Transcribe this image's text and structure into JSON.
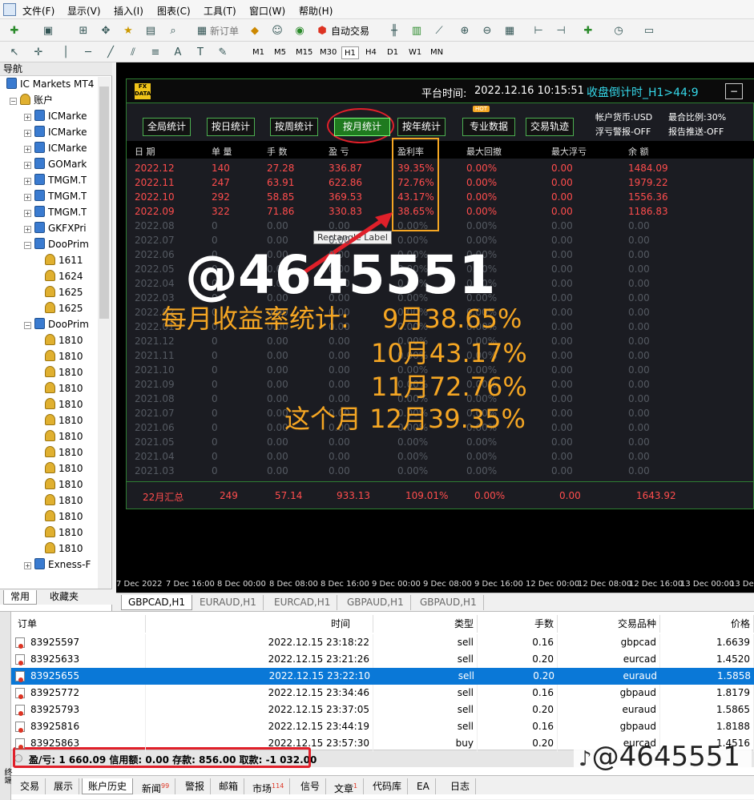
{
  "menu": [
    "文件(F)",
    "显示(V)",
    "插入(I)",
    "图表(C)",
    "工具(T)",
    "窗口(W)",
    "帮助(H)"
  ],
  "toolbar": {
    "new_order": "新订单",
    "auto_trading": "自动交易",
    "timeframes": [
      "M1",
      "M5",
      "M15",
      "M30",
      "H1",
      "H4",
      "D1",
      "W1",
      "MN"
    ],
    "active_tf": "H1"
  },
  "navigator": {
    "title": "导航",
    "root": "IC Markets MT4",
    "accounts_label": "账户",
    "items": [
      {
        "label": "ICMarke",
        "type": "account"
      },
      {
        "label": "ICMarke",
        "type": "account"
      },
      {
        "label": "ICMarke",
        "type": "account"
      },
      {
        "label": "GOMark",
        "type": "account"
      },
      {
        "label": "TMGM.T",
        "type": "account"
      },
      {
        "label": "TMGM.T",
        "type": "account"
      },
      {
        "label": "TMGM.T",
        "type": "account"
      },
      {
        "label": "GKFXPri",
        "type": "account"
      },
      {
        "label": "DooPrim",
        "type": "account"
      },
      {
        "label": "1611",
        "type": "user"
      },
      {
        "label": "1624",
        "type": "user"
      },
      {
        "label": "1625",
        "type": "user"
      },
      {
        "label": "1625",
        "type": "user"
      },
      {
        "label": "DooPrim",
        "type": "account"
      },
      {
        "label": "1810",
        "type": "user"
      },
      {
        "label": "1810",
        "type": "user"
      },
      {
        "label": "1810",
        "type": "user"
      },
      {
        "label": "1810",
        "type": "user"
      },
      {
        "label": "1810",
        "type": "user"
      },
      {
        "label": "1810",
        "type": "user"
      },
      {
        "label": "1810",
        "type": "user"
      },
      {
        "label": "1810",
        "type": "user"
      },
      {
        "label": "1810",
        "type": "user"
      },
      {
        "label": "1810",
        "type": "user"
      },
      {
        "label": "1810",
        "type": "user"
      },
      {
        "label": "1810",
        "type": "user"
      },
      {
        "label": "1810",
        "type": "user"
      },
      {
        "label": "1810",
        "type": "user"
      },
      {
        "label": "Exness-F",
        "type": "account"
      }
    ],
    "tabs": [
      "常用",
      "收藏夹"
    ]
  },
  "panel": {
    "platform_time_label": "平台时间:",
    "platform_time": "2022.12.16 10:15:51",
    "countdown": "收盘倒计时_H1>44:9",
    "close_btn": "−",
    "tabs": [
      "全局统计",
      "按日统计",
      "按周统计",
      "按月统计",
      "按年统计",
      "专业数据",
      "交易轨迹"
    ],
    "active_tab": "按月统计",
    "hot_badge": "HOT",
    "info": {
      "currency": "帐户货币:USD",
      "max_ratio": "最合比例:30%",
      "float_alert": "浮亏警报-OFF",
      "report_push": "报告推送-OFF"
    },
    "columns": [
      "日 期",
      "单 量",
      "手 数",
      "盈 亏",
      "盈利率",
      "最大回撤",
      "最大浮亏",
      "余 额"
    ],
    "rows": [
      [
        "2022.12",
        "140",
        "27.28",
        "336.87",
        "39.35%",
        "0.00%",
        "0.00",
        "1484.09"
      ],
      [
        "2022.11",
        "247",
        "63.91",
        "622.86",
        "72.76%",
        "0.00%",
        "0.00",
        "1979.22"
      ],
      [
        "2022.10",
        "292",
        "58.85",
        "369.53",
        "43.17%",
        "0.00%",
        "0.00",
        "1556.36"
      ],
      [
        "2022.09",
        "322",
        "71.86",
        "330.83",
        "38.65%",
        "0.00%",
        "0.00",
        "1186.83"
      ],
      [
        "2022.08",
        "0",
        "0.00",
        "0.00",
        "0.00%",
        "0.00%",
        "0.00",
        "0.00"
      ],
      [
        "2022.07",
        "0",
        "0.00",
        "0.00",
        "0.00%",
        "0.00%",
        "0.00",
        "0.00"
      ],
      [
        "2022.06",
        "0",
        "0.00",
        "0.00",
        "0.00%",
        "0.00%",
        "0.00",
        "0.00"
      ],
      [
        "2022.05",
        "0",
        "0.00",
        "0.00",
        "0.00%",
        "0.00%",
        "0.00",
        "0.00"
      ],
      [
        "2022.04",
        "0",
        "0.00",
        "0.00",
        "0.00%",
        "0.00%",
        "0.00",
        "0.00"
      ],
      [
        "2022.03",
        "0",
        "0.00",
        "0.00",
        "0.00%",
        "0.00%",
        "0.00",
        "0.00"
      ],
      [
        "2022.02",
        "0",
        "0.00",
        "0.00",
        "0.00%",
        "0.00%",
        "0.00",
        "0.00"
      ],
      [
        "2022.01",
        "0",
        "0.00",
        "0.00",
        "0.00%",
        "0.00%",
        "0.00",
        "0.00"
      ],
      [
        "2021.12",
        "0",
        "0.00",
        "0.00",
        "0.00%",
        "0.00%",
        "0.00",
        "0.00"
      ],
      [
        "2021.11",
        "0",
        "0.00",
        "0.00",
        "0.00%",
        "0.00%",
        "0.00",
        "0.00"
      ],
      [
        "2021.10",
        "0",
        "0.00",
        "0.00",
        "0.00%",
        "0.00%",
        "0.00",
        "0.00"
      ],
      [
        "2021.09",
        "0",
        "0.00",
        "0.00",
        "0.00%",
        "0.00%",
        "0.00",
        "0.00"
      ],
      [
        "2021.08",
        "0",
        "0.00",
        "0.00",
        "0.00%",
        "0.00%",
        "0.00",
        "0.00"
      ],
      [
        "2021.07",
        "0",
        "0.00",
        "0.00",
        "0.00%",
        "0.00%",
        "0.00",
        "0.00"
      ],
      [
        "2021.06",
        "0",
        "0.00",
        "0.00",
        "0.00%",
        "0.00%",
        "0.00",
        "0.00"
      ],
      [
        "2021.05",
        "0",
        "0.00",
        "0.00",
        "0.00%",
        "0.00%",
        "0.00",
        "0.00"
      ],
      [
        "2021.04",
        "0",
        "0.00",
        "0.00",
        "0.00%",
        "0.00%",
        "0.00",
        "0.00"
      ],
      [
        "2021.03",
        "0",
        "0.00",
        "0.00",
        "0.00%",
        "0.00%",
        "0.00",
        "0.00"
      ]
    ],
    "summary": [
      "22月汇总",
      "249",
      "57.14",
      "933.13",
      "109.01%",
      "0.00%",
      "0.00",
      "1643.92"
    ],
    "tooltip": "Rectangle Label"
  },
  "overlay": {
    "handle": "@4645551",
    "line1_label": "每月收益率统计:",
    "line1_value": "9月38.65%",
    "line2": "10月43.17%",
    "line3": "11月72.76%",
    "line4": "这个月 12月39.35%",
    "watermark": "@4645551",
    "colors": {
      "overlay_text": "#f5a623",
      "highlight_box": "#f5a623",
      "circle": "#e0202a"
    }
  },
  "time_axis": [
    "7 Dec 2022",
    "7 Dec 16:00",
    "8 Dec 00:00",
    "8 Dec 08:00",
    "8 Dec 16:00",
    "9 Dec 00:00",
    "9 Dec 08:00",
    "9 Dec 16:00",
    "12 Dec 00:00",
    "12 Dec 08:00",
    "12 Dec 16:00",
    "13 Dec 00:00",
    "13 Dec"
  ],
  "chart_tabs": [
    "GBPCAD,H1",
    "EURAUD,H1",
    "EURCAD,H1",
    "GBPAUD,H1",
    "GBPAUD,H1"
  ],
  "terminal": {
    "side_label": "终端",
    "columns": [
      "订单",
      "时间",
      "类型",
      "手数",
      "交易品种",
      "价格"
    ],
    "rows": [
      [
        "83925597",
        "2022.12.15 23:18:22",
        "sell",
        "0.16",
        "gbpcad",
        "1.6639"
      ],
      [
        "83925633",
        "2022.12.15 23:21:26",
        "sell",
        "0.20",
        "eurcad",
        "1.4520"
      ],
      [
        "83925655",
        "2022.12.15 23:22:10",
        "sell",
        "0.20",
        "euraud",
        "1.5858"
      ],
      [
        "83925772",
        "2022.12.15 23:34:46",
        "sell",
        "0.16",
        "gbpaud",
        "1.8179"
      ],
      [
        "83925793",
        "2022.12.15 23:37:05",
        "sell",
        "0.20",
        "euraud",
        "1.5865"
      ],
      [
        "83925816",
        "2022.12.15 23:44:19",
        "sell",
        "0.16",
        "gbpaud",
        "1.8188"
      ],
      [
        "83925863",
        "2022.12.15 23:57:30",
        "buy",
        "0.20",
        "eurcad",
        "1.4516"
      ]
    ],
    "selected_row": 2,
    "balance": "盈/亏: 1 660.09  信用额: 0.00  存款: 856.00  取款: -1 032.00",
    "tabs": [
      {
        "label": "交易",
        "badge": ""
      },
      {
        "label": "展示",
        "badge": ""
      },
      {
        "label": "账户历史",
        "badge": ""
      },
      {
        "label": "新闻",
        "badge": "99"
      },
      {
        "label": "警报",
        "badge": ""
      },
      {
        "label": "邮箱",
        "badge": ""
      },
      {
        "label": "市场",
        "badge": "114"
      },
      {
        "label": "信号",
        "badge": ""
      },
      {
        "label": "文章",
        "badge": "1"
      },
      {
        "label": "代码库",
        "badge": ""
      },
      {
        "label": "EA",
        "badge": ""
      },
      {
        "label": "日志",
        "badge": ""
      }
    ],
    "active_tab": "账户历史"
  }
}
